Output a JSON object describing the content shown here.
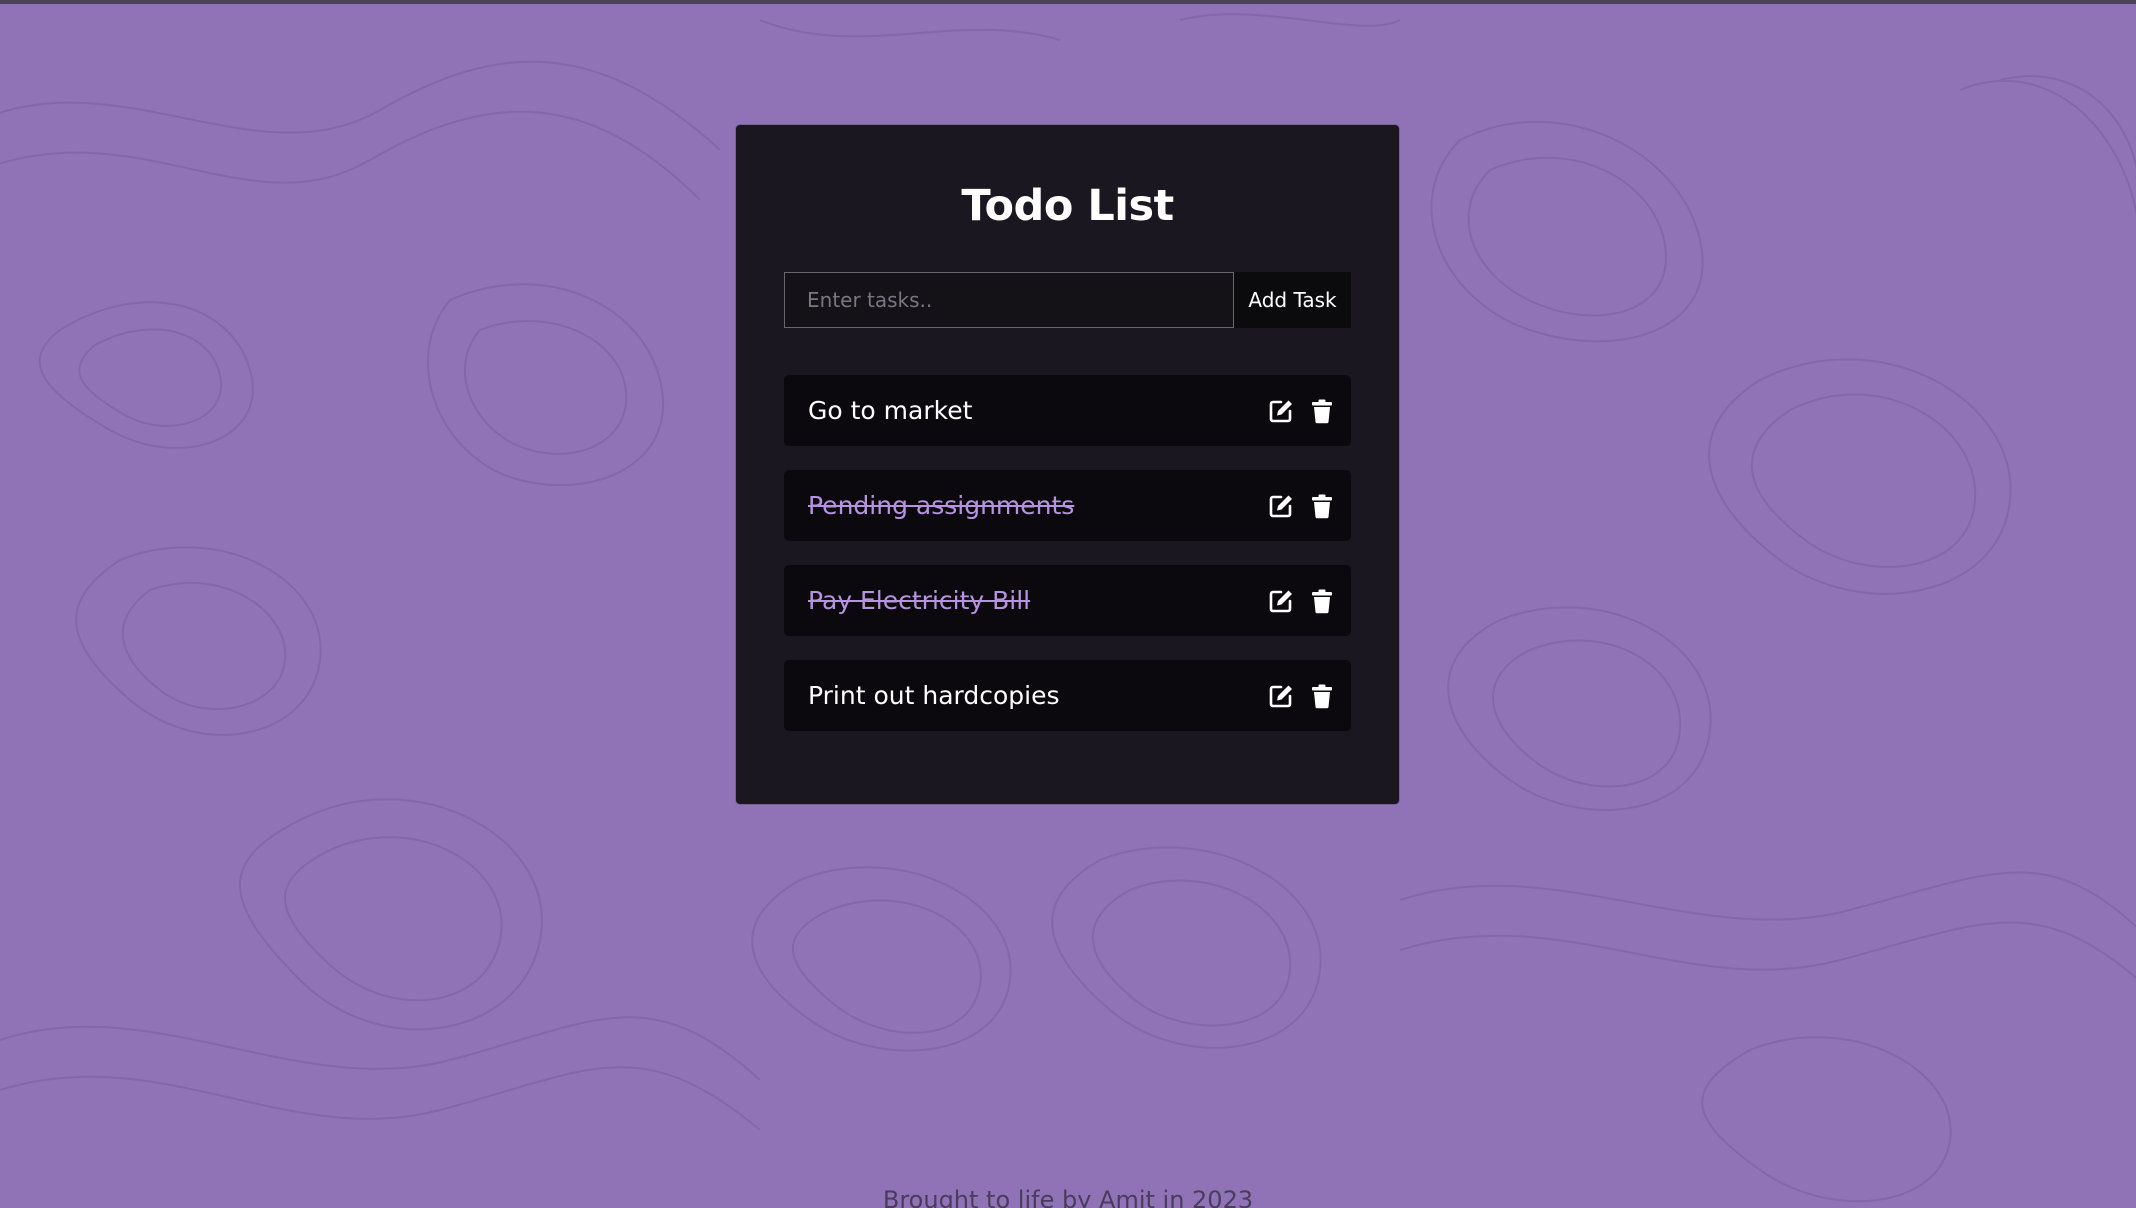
{
  "app": {
    "title": "Todo List"
  },
  "input": {
    "value": "",
    "placeholder": "Enter tasks.."
  },
  "add_button": {
    "label": "Add Task"
  },
  "tasks": [
    {
      "text": "Go to market",
      "completed": false
    },
    {
      "text": "Pending assignments",
      "completed": true
    },
    {
      "text": "Pay Electricity Bill",
      "completed": true
    },
    {
      "text": "Print out hardcopies",
      "completed": false
    }
  ],
  "icons": {
    "edit": "edit-icon",
    "delete": "trash-icon"
  },
  "footer": {
    "text": "Brought to life by Amit in 2023"
  },
  "colors": {
    "background": "#8f73b6",
    "card": "#1b1720",
    "item": "#0b090d",
    "completed_text": "#b593e0"
  }
}
